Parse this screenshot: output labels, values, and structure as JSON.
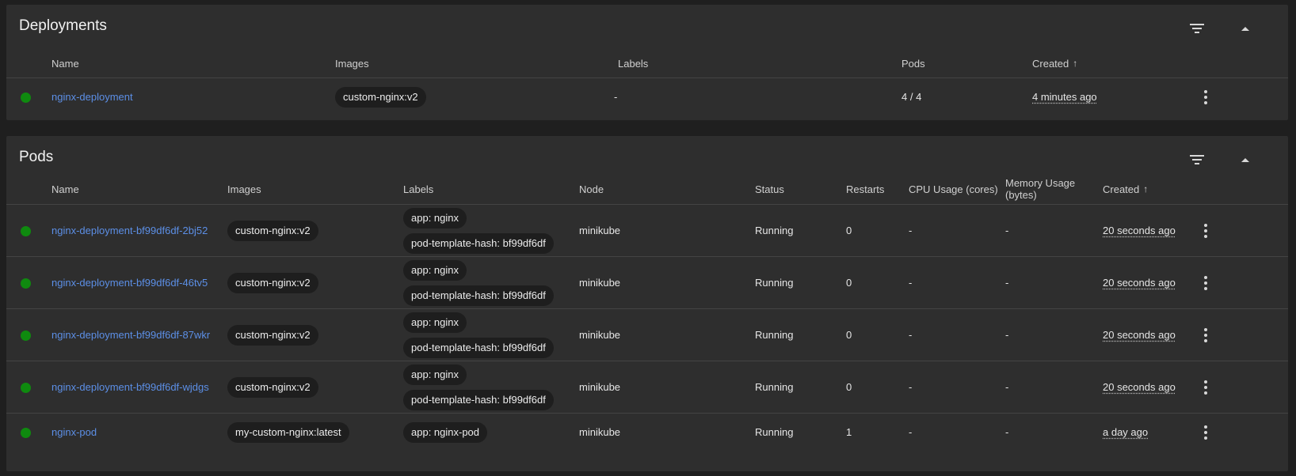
{
  "deployments": {
    "title": "Deployments",
    "columns": {
      "name": "Name",
      "images": "Images",
      "labels": "Labels",
      "pods": "Pods",
      "created": "Created",
      "sort_arrow": "↑"
    },
    "rows": [
      {
        "name": "nginx-deployment",
        "image": "custom-nginx:v2",
        "labels": "-",
        "pods": "4 / 4",
        "created": "4 minutes ago",
        "status_color": "#0f8a0f"
      }
    ]
  },
  "pods": {
    "title": "Pods",
    "columns": {
      "name": "Name",
      "images": "Images",
      "labels": "Labels",
      "node": "Node",
      "status": "Status",
      "restarts": "Restarts",
      "cpu": "CPU Usage (cores)",
      "memory_line1": "Memory Usage",
      "memory_line2": "(bytes)",
      "created": "Created",
      "sort_arrow": "↑"
    },
    "rows": [
      {
        "name": "nginx-deployment-bf99df6df-2bj52",
        "image": "custom-nginx:v2",
        "labels": [
          "app: nginx",
          "pod-template-hash: bf99df6df"
        ],
        "node": "minikube",
        "status": "Running",
        "restarts": "0",
        "cpu": "-",
        "memory": "-",
        "created": "20 seconds ago"
      },
      {
        "name": "nginx-deployment-bf99df6df-46tv5",
        "image": "custom-nginx:v2",
        "labels": [
          "app: nginx",
          "pod-template-hash: bf99df6df"
        ],
        "node": "minikube",
        "status": "Running",
        "restarts": "0",
        "cpu": "-",
        "memory": "-",
        "created": "20 seconds ago"
      },
      {
        "name": "nginx-deployment-bf99df6df-87wkr",
        "image": "custom-nginx:v2",
        "labels": [
          "app: nginx",
          "pod-template-hash: bf99df6df"
        ],
        "node": "minikube",
        "status": "Running",
        "restarts": "0",
        "cpu": "-",
        "memory": "-",
        "created": "20 seconds ago"
      },
      {
        "name": "nginx-deployment-bf99df6df-wjdgs",
        "image": "custom-nginx:v2",
        "labels": [
          "app: nginx",
          "pod-template-hash: bf99df6df"
        ],
        "node": "minikube",
        "status": "Running",
        "restarts": "0",
        "cpu": "-",
        "memory": "-",
        "created": "20 seconds ago"
      },
      {
        "name": "nginx-pod",
        "image": "my-custom-nginx:latest",
        "labels": [
          "app: nginx-pod"
        ],
        "node": "minikube",
        "status": "Running",
        "restarts": "1",
        "cpu": "-",
        "memory": "-",
        "created": "a day ago"
      }
    ]
  },
  "icons": {
    "filter": "filter-icon",
    "collapse": "caret-up-icon",
    "status": "status-dot-icon",
    "menu": "more-vert-icon"
  },
  "colors": {
    "background": "#1f1f1f",
    "card": "#2e2e2e",
    "link": "#5c8fe6",
    "status_ok": "#0f8a0f"
  }
}
